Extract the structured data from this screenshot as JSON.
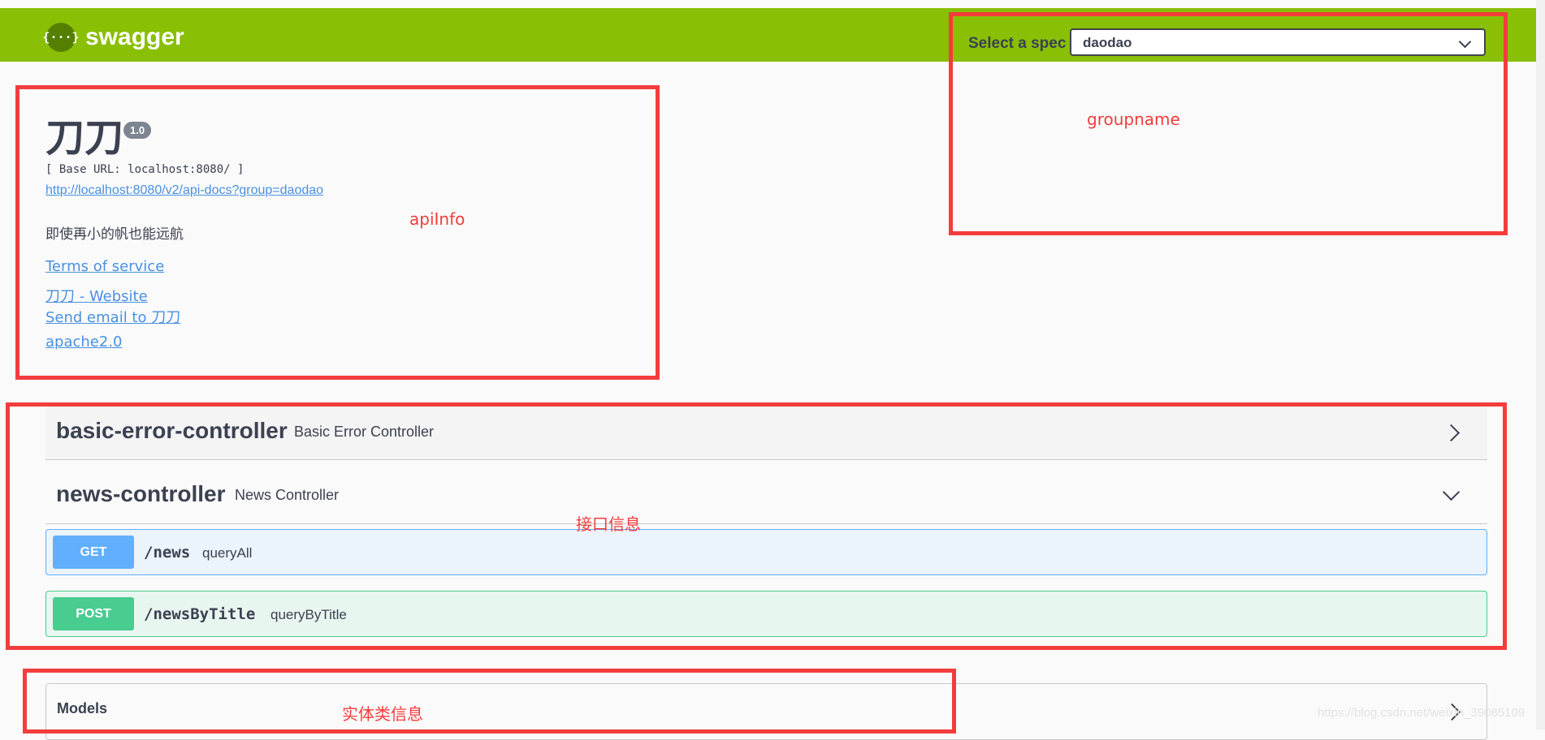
{
  "topbar": {
    "logo_text": "swagger",
    "logo_icon_glyph": "{···}",
    "spec_label": "Select a spec",
    "spec_selected": "daodao",
    "background_color": "#89bf04"
  },
  "info": {
    "title": "刀刀",
    "version": "1.0",
    "base_url": "[ Base URL: localhost:8080/ ]",
    "api_docs_link": "http://localhost:8080/v2/api-docs?group=daodao",
    "description": "即使再小的帆也能远航",
    "terms_link": "Terms of service",
    "website_link": "刀刀 - Website",
    "email_link": "Send email to 刀刀",
    "license_link": "apache2.0"
  },
  "annotations": {
    "groupname": "groupname",
    "apiinfo": "apiInfo",
    "interface_info": "接口信息",
    "model_info": "实体类信息",
    "color": "#f33d3d"
  },
  "tags": [
    {
      "name": "basic-error-controller",
      "description": "Basic Error Controller",
      "expanded": false
    },
    {
      "name": "news-controller",
      "description": "News Controller",
      "expanded": true
    }
  ],
  "operations": [
    {
      "method": "GET",
      "path": "/news",
      "summary": "queryAll",
      "color": "#61affe"
    },
    {
      "method": "POST",
      "path": "/newsByTitle",
      "summary": "queryByTitle",
      "color": "#49cc90"
    }
  ],
  "models": {
    "title": "Models"
  },
  "watermark": "https://blog.csdn.net/weixin_39085109"
}
